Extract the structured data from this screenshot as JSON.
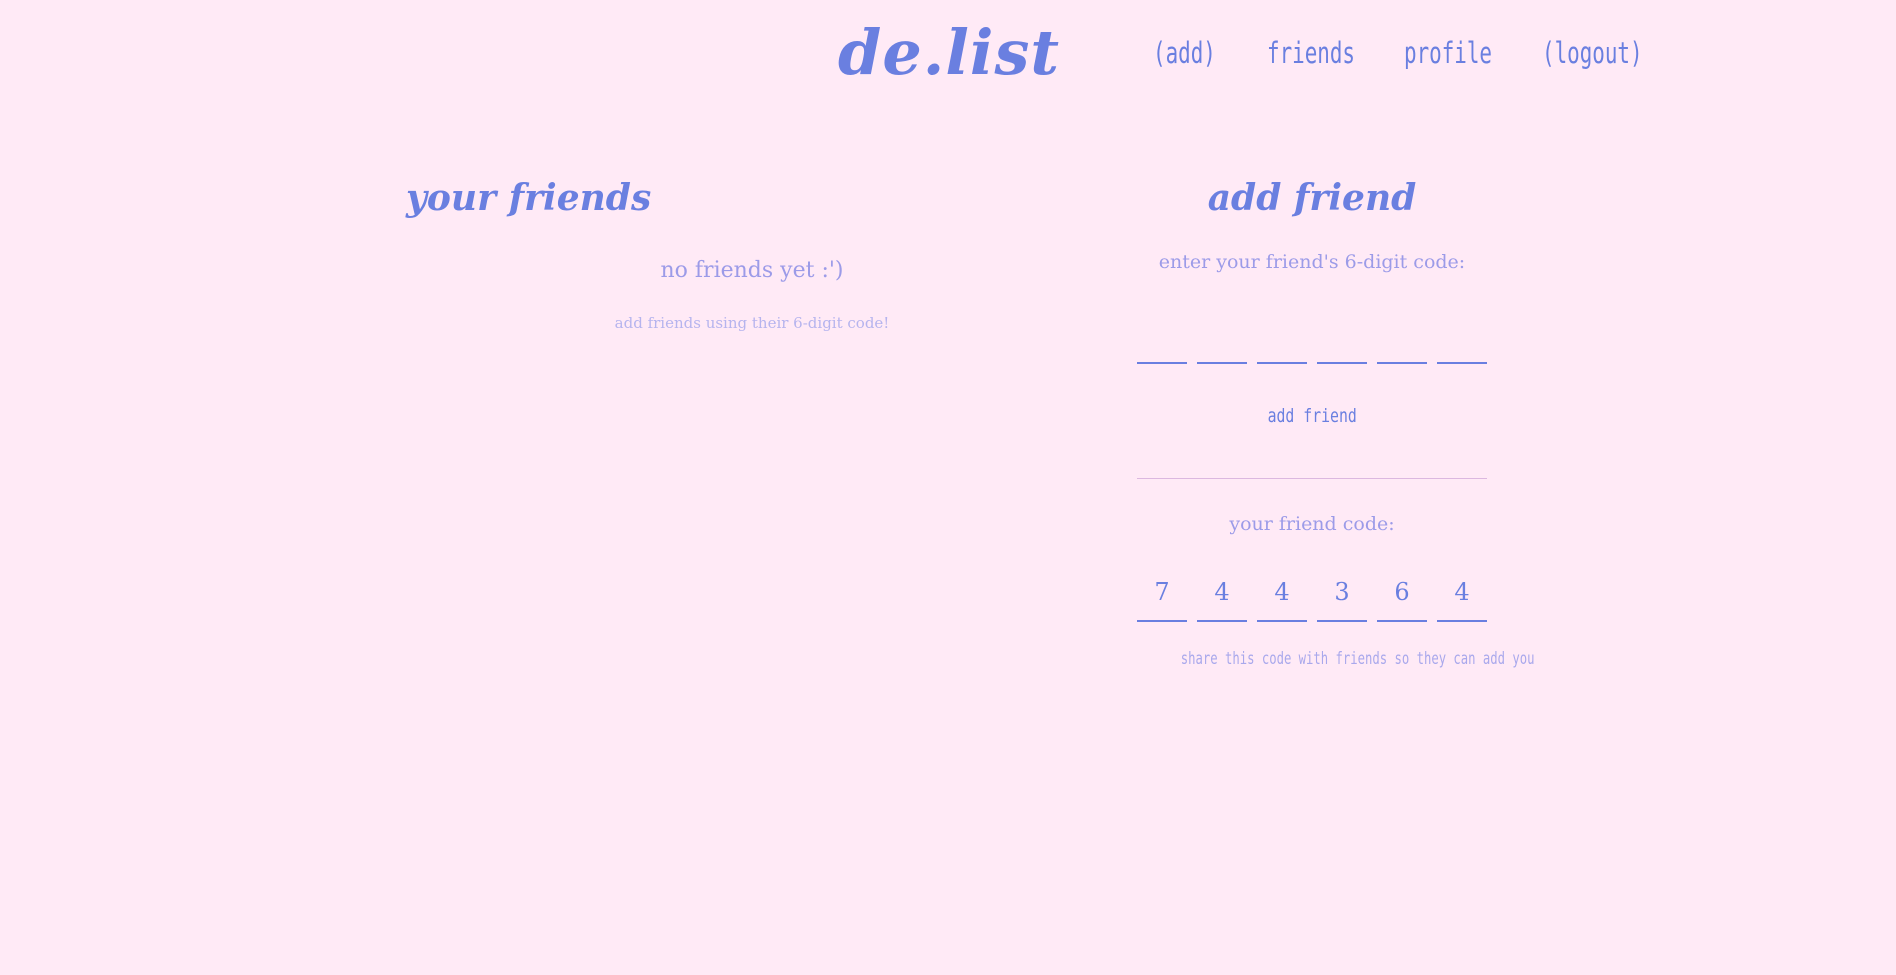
{
  "app": {
    "logo": "de.list"
  },
  "nav": {
    "add": "(add)",
    "friends": "friends",
    "profile": "profile",
    "logout": "(logout)"
  },
  "friends_panel": {
    "title": "your friends",
    "empty_message": "no friends yet :')",
    "empty_hint": "add friends using their 6-digit code!"
  },
  "add_friend_panel": {
    "title": "add friend",
    "prompt": "enter your friend's 6-digit code:",
    "code_inputs": [
      "",
      "",
      "",
      "",
      "",
      ""
    ],
    "submit_label": "add friend",
    "your_code_label": "your friend code:",
    "your_code_digits": [
      "7",
      "4",
      "4",
      "3",
      "6",
      "4"
    ],
    "share_note": "share this code with friends so they can add you"
  },
  "colors": {
    "background": "#ffeaf6",
    "accent": "#6a7fe0",
    "muted": "#9c9be8"
  }
}
